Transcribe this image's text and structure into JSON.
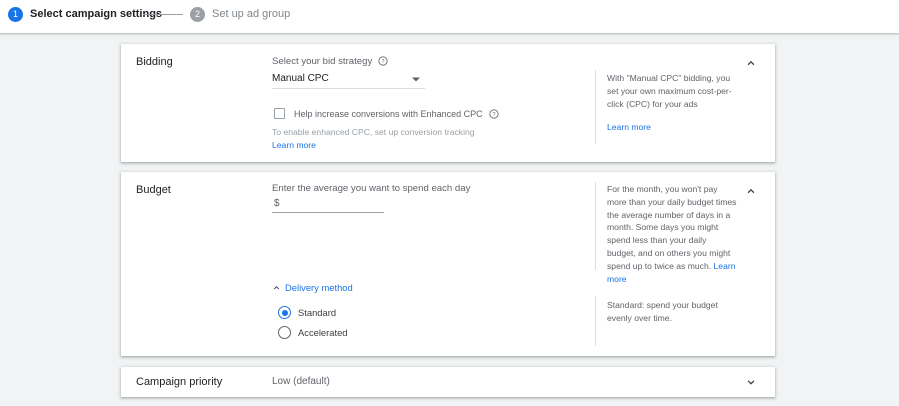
{
  "stepper": {
    "steps": [
      {
        "number": "1",
        "label": "Select campaign settings"
      },
      {
        "number": "2",
        "label": "Set up ad group"
      }
    ]
  },
  "bidding": {
    "title": "Bidding",
    "strategy_label": "Select your bid strategy",
    "strategy_value": "Manual CPC",
    "enhanced_cpc_label": "Help increase conversions with Enhanced CPC",
    "enhanced_cpc_checked": false,
    "hint": "To enable enhanced CPC, set up conversion tracking",
    "learn_more": "Learn more",
    "help_text": "With \"Manual CPC\" bidding, you set your own maximum cost-per-click (CPC) for your ads",
    "help_link": "Learn more"
  },
  "budget": {
    "title": "Budget",
    "field_label": "Enter the average you want to spend each day",
    "currency_symbol": "$",
    "value": "",
    "help_text": "For the month, you won't pay more than your daily budget times the average number of days in a month. Some days you might spend less than your daily budget, and on others you might spend up to twice as much.",
    "help_link": "Learn more",
    "delivery_method": {
      "label": "Delivery method",
      "options": [
        {
          "label": "Standard",
          "selected": true
        },
        {
          "label": "Accelerated",
          "selected": false
        }
      ],
      "help_text": "Standard: spend your budget evenly over time."
    }
  },
  "priority": {
    "title": "Campaign priority",
    "value": "Low (default)"
  },
  "colors": {
    "accent": "#1a73e8",
    "inactive": "#9aa0a6",
    "text": "#3c4043",
    "background": "#f1f3f4"
  },
  "icons": [
    "help-circle-icon",
    "dropdown-caret-icon",
    "chevron-up-icon",
    "chevron-down-icon"
  ]
}
